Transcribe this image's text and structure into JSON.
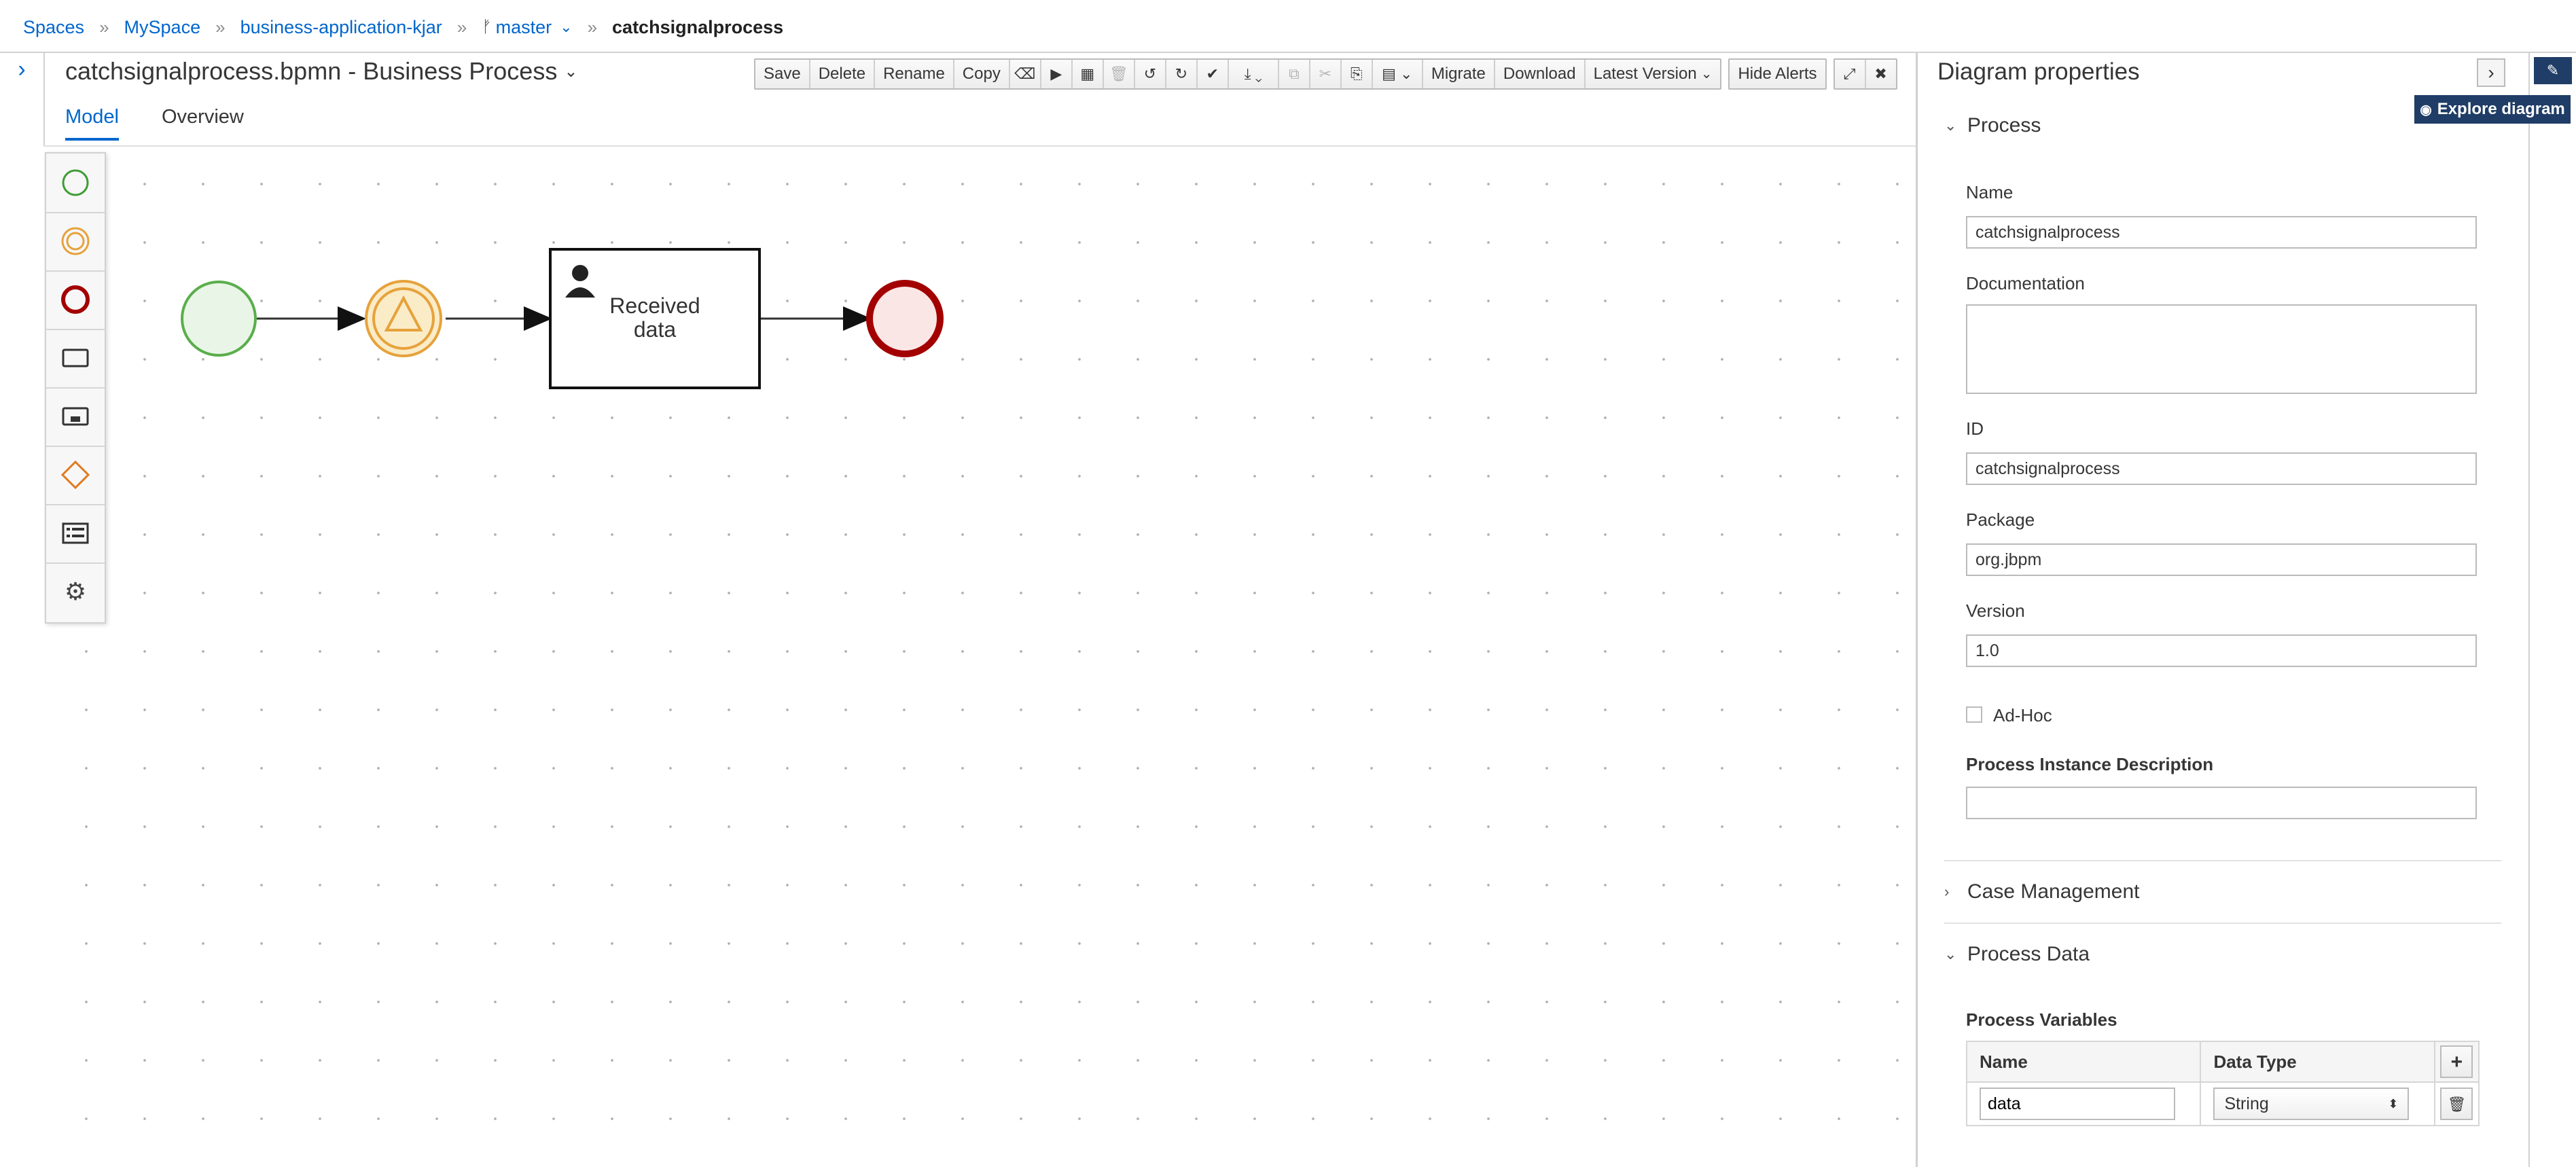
{
  "breadcrumb": {
    "items": [
      "Spaces",
      "MySpace",
      "business-application-kjar",
      "master",
      "catchsignalprocess"
    ],
    "separator": "»"
  },
  "editor": {
    "title": "catchsignalprocess.bpmn - Business Process",
    "title_caret": "⌄"
  },
  "toolbar": {
    "save": "Save",
    "delete": "Delete",
    "rename": "Rename",
    "copy": "Copy",
    "migrate": "Migrate",
    "download": "Download",
    "latest_version": "Latest Version",
    "hide_alerts": "Hide Alerts"
  },
  "tabs": {
    "model": "Model",
    "overview": "Overview"
  },
  "diagram": {
    "task_label_line1": "Received",
    "task_label_line2": "data"
  },
  "panel": {
    "title": "Diagram properties",
    "explore": "Explore diagram",
    "sections": {
      "process": "Process",
      "case_management": "Case Management",
      "process_data": "Process Data"
    },
    "fields": {
      "name_label": "Name",
      "name_value": "catchsignalprocess",
      "documentation_label": "Documentation",
      "documentation_value": "",
      "id_label": "ID",
      "id_value": "catchsignalprocess",
      "package_label": "Package",
      "package_value": "org.jbpm",
      "version_label": "Version",
      "version_value": "1.0",
      "adhoc_label": "Ad-Hoc",
      "adhoc_checked": false,
      "instance_desc_label": "Process Instance Description",
      "instance_desc_value": ""
    },
    "variables": {
      "label": "Process Variables",
      "col_name": "Name",
      "col_type": "Data Type",
      "rows": [
        {
          "name": "data",
          "type": "String"
        }
      ]
    }
  },
  "colors": {
    "link": "#0066cc",
    "start_event": "#3f9c35",
    "intermediate_event": "#e6a23c",
    "end_event": "#a30000",
    "navy": "#1f3d66"
  }
}
